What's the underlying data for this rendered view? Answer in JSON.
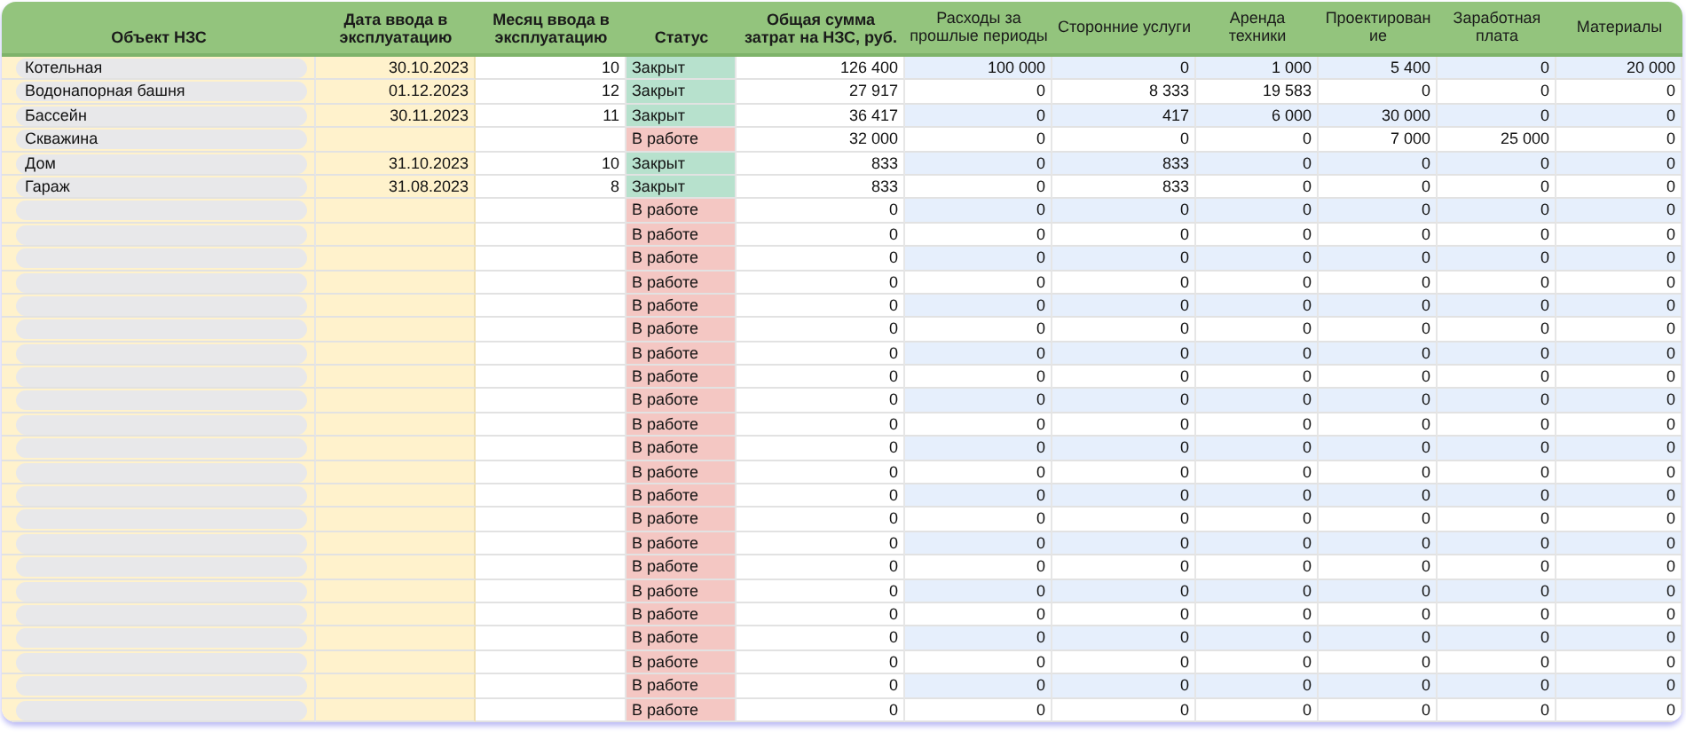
{
  "table": {
    "columns": [
      "Объект НЗС",
      "Дата ввода в эксплуатацию",
      "Месяц ввода в эксплуатацию",
      "Статус",
      "Общая сумма затрат на НЗС, руб.",
      "Расходы за прошлые периоды",
      "Сторонние услуги",
      "Аренда техники",
      "Проектирован ие",
      "Заработная плата",
      "Материалы"
    ],
    "rows": [
      {
        "object": "Котельная",
        "date": "30.10.2023",
        "month": "10",
        "status": {
          "text": "Закрыт",
          "kind": "closed"
        },
        "total": "126 400",
        "costs": [
          "100 000",
          "0",
          "1 000",
          "5 400",
          "0",
          "20 000"
        ]
      },
      {
        "object": "Водонапорная башня",
        "date": "01.12.2023",
        "month": "12",
        "status": {
          "text": "Закрыт",
          "kind": "closed"
        },
        "total": "27 917",
        "costs": [
          "0",
          "8 333",
          "19 583",
          "0",
          "0",
          "0"
        ]
      },
      {
        "object": "Бассейн",
        "date": "30.11.2023",
        "month": "11",
        "status": {
          "text": "Закрыт",
          "kind": "closed"
        },
        "total": "36 417",
        "costs": [
          "0",
          "417",
          "6 000",
          "30 000",
          "0",
          "0"
        ]
      },
      {
        "object": "Скважина",
        "status": {
          "text": "В работе",
          "kind": "open"
        },
        "total": "32 000",
        "costs": [
          "0",
          "0",
          "0",
          "7 000",
          "25 000",
          "0"
        ]
      },
      {
        "object": "Дом",
        "date": "31.10.2023",
        "month": "10",
        "status": {
          "text": "Закрыт",
          "kind": "closed"
        },
        "total": "833",
        "costs": [
          "0",
          "833",
          "0",
          "0",
          "0",
          "0"
        ]
      },
      {
        "object": "Гараж",
        "date": "31.08.2023",
        "month": "8",
        "status": {
          "text": "Закрыт",
          "kind": "closed"
        },
        "total": "833",
        "costs": [
          "0",
          "833",
          "0",
          "0",
          "0",
          "0"
        ]
      },
      {
        "status": {
          "text": "В работе",
          "kind": "open"
        },
        "total": "0",
        "costs": [
          "0",
          "0",
          "0",
          "0",
          "0",
          "0"
        ]
      },
      {
        "status": {
          "text": "В работе",
          "kind": "open"
        },
        "total": "0",
        "costs": [
          "0",
          "0",
          "0",
          "0",
          "0",
          "0"
        ]
      },
      {
        "status": {
          "text": "В работе",
          "kind": "open"
        },
        "total": "0",
        "costs": [
          "0",
          "0",
          "0",
          "0",
          "0",
          "0"
        ]
      },
      {
        "status": {
          "text": "В работе",
          "kind": "open"
        },
        "total": "0",
        "costs": [
          "0",
          "0",
          "0",
          "0",
          "0",
          "0"
        ]
      },
      {
        "status": {
          "text": "В работе",
          "kind": "open"
        },
        "total": "0",
        "costs": [
          "0",
          "0",
          "0",
          "0",
          "0",
          "0"
        ]
      },
      {
        "status": {
          "text": "В работе",
          "kind": "open"
        },
        "total": "0",
        "costs": [
          "0",
          "0",
          "0",
          "0",
          "0",
          "0"
        ]
      },
      {
        "status": {
          "text": "В работе",
          "kind": "open"
        },
        "total": "0",
        "costs": [
          "0",
          "0",
          "0",
          "0",
          "0",
          "0"
        ]
      },
      {
        "status": {
          "text": "В работе",
          "kind": "open"
        },
        "total": "0",
        "costs": [
          "0",
          "0",
          "0",
          "0",
          "0",
          "0"
        ]
      },
      {
        "status": {
          "text": "В работе",
          "kind": "open"
        },
        "total": "0",
        "costs": [
          "0",
          "0",
          "0",
          "0",
          "0",
          "0"
        ]
      },
      {
        "status": {
          "text": "В работе",
          "kind": "open"
        },
        "total": "0",
        "costs": [
          "0",
          "0",
          "0",
          "0",
          "0",
          "0"
        ]
      },
      {
        "status": {
          "text": "В работе",
          "kind": "open"
        },
        "total": "0",
        "costs": [
          "0",
          "0",
          "0",
          "0",
          "0",
          "0"
        ]
      },
      {
        "status": {
          "text": "В работе",
          "kind": "open"
        },
        "total": "0",
        "costs": [
          "0",
          "0",
          "0",
          "0",
          "0",
          "0"
        ]
      },
      {
        "status": {
          "text": "В работе",
          "kind": "open"
        },
        "total": "0",
        "costs": [
          "0",
          "0",
          "0",
          "0",
          "0",
          "0"
        ]
      },
      {
        "status": {
          "text": "В работе",
          "kind": "open"
        },
        "total": "0",
        "costs": [
          "0",
          "0",
          "0",
          "0",
          "0",
          "0"
        ]
      },
      {
        "status": {
          "text": "В работе",
          "kind": "open"
        },
        "total": "0",
        "costs": [
          "0",
          "0",
          "0",
          "0",
          "0",
          "0"
        ]
      },
      {
        "status": {
          "text": "В работе",
          "kind": "open"
        },
        "total": "0",
        "costs": [
          "0",
          "0",
          "0",
          "0",
          "0",
          "0"
        ]
      },
      {
        "status": {
          "text": "В работе",
          "kind": "open"
        },
        "total": "0",
        "costs": [
          "0",
          "0",
          "0",
          "0",
          "0",
          "0"
        ]
      },
      {
        "status": {
          "text": "В работе",
          "kind": "open"
        },
        "total": "0",
        "costs": [
          "0",
          "0",
          "0",
          "0",
          "0",
          "0"
        ]
      },
      {
        "status": {
          "text": "В работе",
          "kind": "open"
        },
        "total": "0",
        "costs": [
          "0",
          "0",
          "0",
          "0",
          "0",
          "0"
        ]
      },
      {
        "status": {
          "text": "В работе",
          "kind": "open"
        },
        "total": "0",
        "costs": [
          "0",
          "0",
          "0",
          "0",
          "0",
          "0"
        ]
      },
      {
        "status": {
          "text": "В работе",
          "kind": "open"
        },
        "total": "0",
        "costs": [
          "0",
          "0",
          "0",
          "0",
          "0",
          "0"
        ]
      },
      {
        "status": {
          "text": "В работе",
          "kind": "open"
        },
        "total": "0",
        "costs": [
          "0",
          "0",
          "0",
          "0",
          "0",
          "0"
        ]
      }
    ]
  }
}
